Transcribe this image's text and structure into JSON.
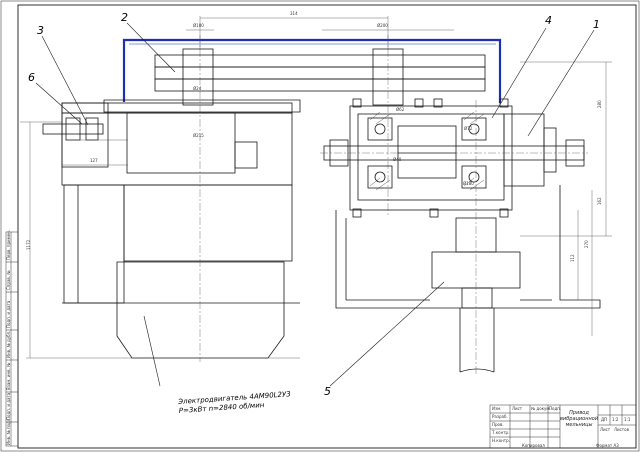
{
  "drawing": {
    "callouts": [
      "1",
      "2",
      "3",
      "4",
      "5",
      "6"
    ],
    "motor_note": {
      "line1": "Электродвигатель 4АМ90L2У3",
      "line2": "P=3кВт  n=2840 об/мин"
    },
    "dimensions": {
      "center_distance": "314",
      "pulley_small": "Ø100",
      "pulley_large": "Ø200",
      "shaft_motor": "Ø24",
      "motor_base": "Ø215",
      "motor_offset": "127",
      "bearing1": "Ø62",
      "bearing2": "Ø72",
      "gear1": "Ø40",
      "gear2": "Ø180",
      "frame_height": "1172",
      "right_top": "280",
      "right_mid": "162",
      "right_low": "270",
      "right_bottom": "112"
    },
    "colors": {
      "line": "#1a1a1a",
      "belt": "#1f2fb5",
      "label": "#000000"
    }
  },
  "title_block": {
    "title": "Привод вибрационной мельницы",
    "sheet_code": "ДП",
    "mass": "1:2",
    "scale": "1:1",
    "sheet": "Лист",
    "sheets": "Листов",
    "copied": "Копировал",
    "format": "Формат А3",
    "rows": [
      "Изм.",
      "Лист",
      "№ докум.",
      "Подп.",
      "Дата"
    ],
    "roles": [
      "Разраб.",
      "Пров.",
      "Т.контр.",
      "Н.контр.",
      "Утв."
    ]
  },
  "left_strip": {
    "cells": [
      "Перв. примен.",
      "Справ. №",
      "Подп. и дата",
      "Инв. № дубл.",
      "Взам. инв. №",
      "Подп. и дата",
      "Инв. № подл."
    ]
  }
}
